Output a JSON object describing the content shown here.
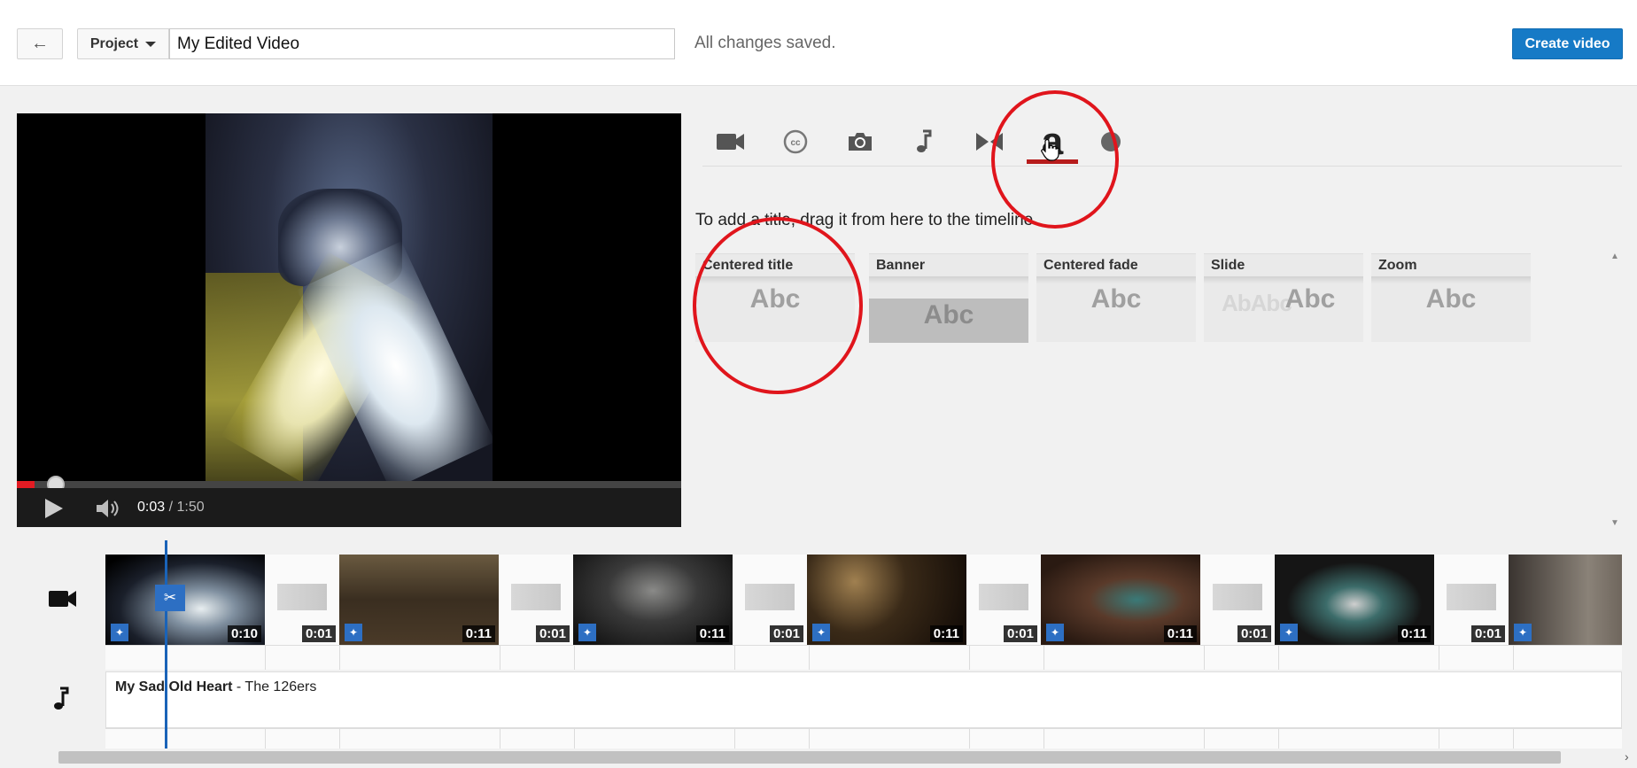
{
  "header": {
    "back_label": "←",
    "project_label": "Project",
    "title_value": "My Edited Video",
    "status": "All changes saved.",
    "create_label": "Create video"
  },
  "player": {
    "current_time": "0:03",
    "duration": "/ 1:50",
    "progress": 0.027
  },
  "tools": {
    "items": [
      {
        "name": "video-camera-icon"
      },
      {
        "name": "closed-captions-icon"
      },
      {
        "name": "photo-camera-icon"
      },
      {
        "name": "music-note-icon"
      },
      {
        "name": "transitions-icon"
      },
      {
        "name": "text-titles-icon",
        "glyph": "a",
        "active": true
      },
      {
        "name": "help-icon"
      }
    ]
  },
  "titles_panel": {
    "instruction": "To add a title, drag it from here to the timeline.",
    "cards": [
      {
        "label": "Centered title",
        "sample": "Abc"
      },
      {
        "label": "Banner",
        "sample": "Abc"
      },
      {
        "label": "Centered fade",
        "sample": "Abc"
      },
      {
        "label": "Slide",
        "sample": "Abc",
        "ghost": "AbAbc"
      },
      {
        "label": "Zoom",
        "sample": "Abc"
      }
    ]
  },
  "timeline": {
    "clips": [
      {
        "duration": "0:10"
      },
      {
        "duration": "0:11"
      },
      {
        "duration": "0:11"
      },
      {
        "duration": "0:11"
      },
      {
        "duration": "0:11"
      },
      {
        "duration": "0:11"
      },
      {
        "duration": ""
      }
    ],
    "transitions": [
      {
        "duration": "0:01"
      },
      {
        "duration": "0:01"
      },
      {
        "duration": "0:01"
      },
      {
        "duration": "0:01"
      },
      {
        "duration": "0:01"
      },
      {
        "duration": "0:01"
      }
    ],
    "audio": {
      "song": "My Sad Old Heart",
      "artist": " - The 126ers"
    }
  },
  "colors": {
    "accent": "#167ac6",
    "annotation_red": "#e0151c",
    "active_tab": "#b71c1c",
    "progress_red": "#e31b23"
  }
}
